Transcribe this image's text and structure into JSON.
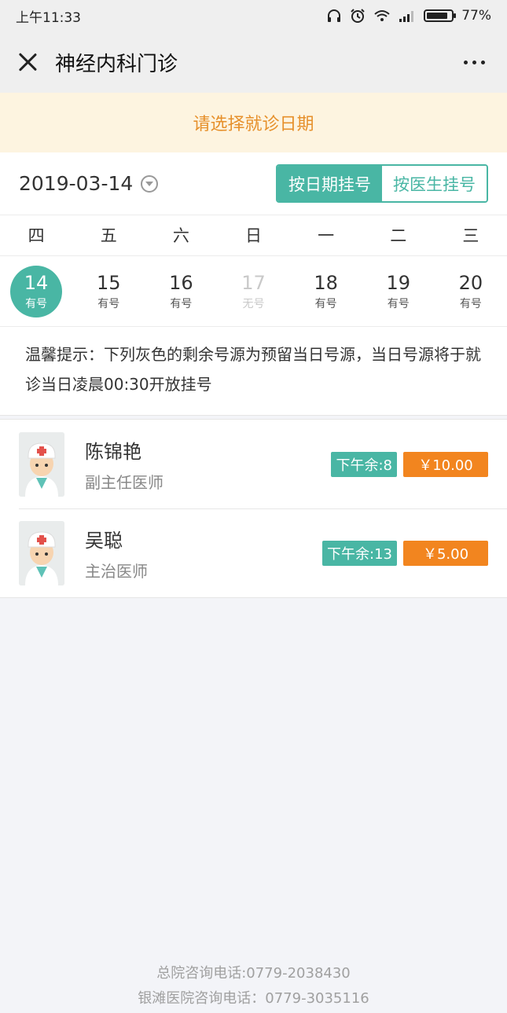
{
  "status_bar": {
    "time": "上午11:33",
    "battery": "77%"
  },
  "nav": {
    "title": "神经内科门诊"
  },
  "banner": {
    "text": "请选择就诊日期"
  },
  "date_selector": {
    "date": "2019-03-14",
    "mode_by_date": "按日期挂号",
    "mode_by_doctor": "按医生挂号"
  },
  "weekdays": [
    "四",
    "五",
    "六",
    "日",
    "一",
    "二",
    "三"
  ],
  "days": [
    {
      "num": "14",
      "status": "有号"
    },
    {
      "num": "15",
      "status": "有号"
    },
    {
      "num": "16",
      "status": "有号"
    },
    {
      "num": "17",
      "status": "无号"
    },
    {
      "num": "18",
      "status": "有号"
    },
    {
      "num": "19",
      "status": "有号"
    },
    {
      "num": "20",
      "status": "有号"
    }
  ],
  "tip": {
    "text": "温馨提示：下列灰色的剩余号源为预留当日号源，当日号源将于就诊当日凌晨00:30开放挂号"
  },
  "doctors": [
    {
      "name": "陈锦艳",
      "title": "副主任医师",
      "slots": "下午余:8",
      "price": "￥10.00"
    },
    {
      "name": "吴聪",
      "title": "主治医师",
      "slots": "下午余:13",
      "price": "￥5.00"
    }
  ],
  "footer": {
    "line1": "总院咨询电话:0779-2038430",
    "line2": "银滩医院咨询电话：0779-3035116"
  },
  "colors": {
    "accent": "#49b6a4",
    "price": "#f2851f",
    "banner_text": "#e6902b",
    "banner_bg": "#fdf4e0"
  }
}
